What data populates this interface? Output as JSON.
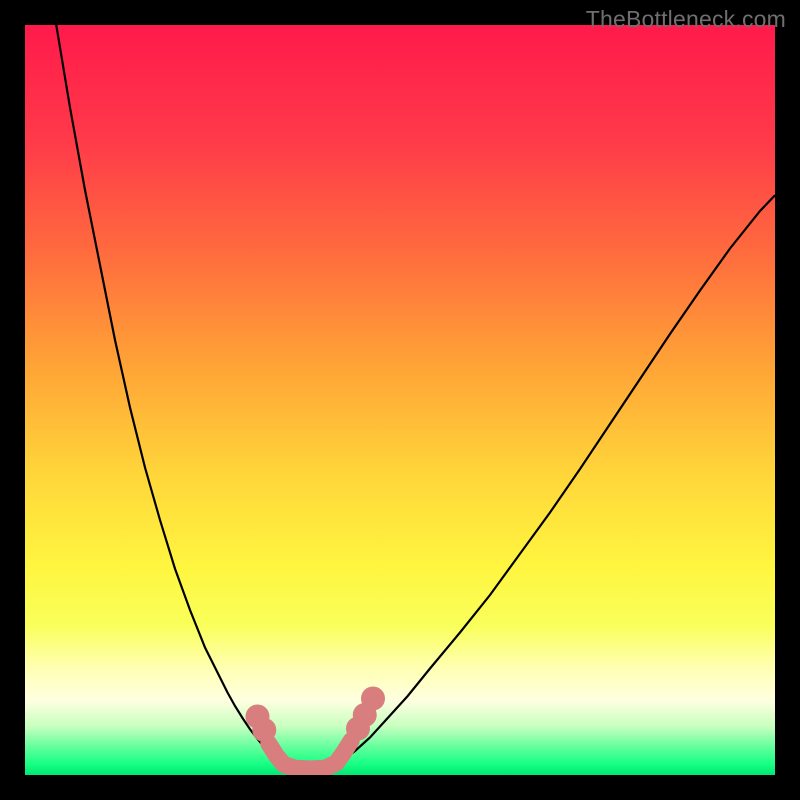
{
  "watermark": "TheBottleneck.com",
  "chart_data": {
    "type": "line",
    "title": "",
    "xlabel": "",
    "ylabel": "",
    "xlim": [
      0,
      100
    ],
    "ylim": [
      0,
      100
    ],
    "grid": false,
    "gradient_stops": [
      {
        "offset": 0.0,
        "color": "#ff1a4b"
      },
      {
        "offset": 0.15,
        "color": "#ff394a"
      },
      {
        "offset": 0.3,
        "color": "#ff6a3e"
      },
      {
        "offset": 0.45,
        "color": "#ffa236"
      },
      {
        "offset": 0.6,
        "color": "#ffd63a"
      },
      {
        "offset": 0.72,
        "color": "#fff53f"
      },
      {
        "offset": 0.8,
        "color": "#f9ff5a"
      },
      {
        "offset": 0.86,
        "color": "#ffffb5"
      },
      {
        "offset": 0.9,
        "color": "#ffffe0"
      },
      {
        "offset": 0.935,
        "color": "#c8ffc0"
      },
      {
        "offset": 0.965,
        "color": "#5bff9a"
      },
      {
        "offset": 0.985,
        "color": "#18ff84"
      },
      {
        "offset": 1.0,
        "color": "#00e874"
      }
    ],
    "series": [
      {
        "name": "left-curve",
        "stroke": "#000000",
        "stroke_width": 2.2,
        "x": [
          4,
          6,
          8,
          10,
          12,
          14,
          16,
          18,
          20,
          22,
          24,
          26,
          27,
          28,
          29,
          30,
          31,
          32,
          33,
          34.5
        ],
        "y": [
          101,
          89,
          78,
          68,
          58,
          49,
          41,
          34,
          27.5,
          22,
          17,
          13,
          11,
          9.2,
          7.6,
          6.1,
          4.8,
          3.6,
          2.5,
          1.5
        ]
      },
      {
        "name": "right-curve",
        "stroke": "#000000",
        "stroke_width": 2.2,
        "x": [
          42,
          44,
          46,
          48,
          51,
          54,
          58,
          62,
          66,
          70,
          74,
          78,
          82,
          86,
          90,
          94,
          98,
          100
        ],
        "y": [
          1.7,
          3.2,
          5.0,
          7.2,
          10.5,
          14.2,
          19.0,
          24.0,
          29.5,
          35.0,
          40.8,
          46.8,
          52.8,
          58.8,
          64.6,
          70.2,
          75.2,
          77.3
        ]
      },
      {
        "name": "valley-worm",
        "stroke": "#d97e7e",
        "stroke_width": 17,
        "linecap": "round",
        "x": [
          32.5,
          33.5,
          34.5,
          36,
          38,
          40,
          41.5,
          42.5,
          43.5
        ],
        "y": [
          4.2,
          2.6,
          1.4,
          0.9,
          0.8,
          0.9,
          1.6,
          3.0,
          4.6
        ]
      }
    ],
    "dots": [
      {
        "name": "left-dot-1",
        "cx": 31.0,
        "cy": 7.8,
        "r": 1.6,
        "fill": "#d97e7e"
      },
      {
        "name": "left-dot-2",
        "cx": 31.9,
        "cy": 6.0,
        "r": 1.6,
        "fill": "#d97e7e"
      },
      {
        "name": "right-dot-1",
        "cx": 44.4,
        "cy": 6.2,
        "r": 1.6,
        "fill": "#d97e7e"
      },
      {
        "name": "right-dot-2",
        "cx": 45.3,
        "cy": 8.0,
        "r": 1.6,
        "fill": "#d97e7e"
      },
      {
        "name": "right-dot-3",
        "cx": 46.4,
        "cy": 10.2,
        "r": 1.6,
        "fill": "#d97e7e"
      }
    ]
  }
}
